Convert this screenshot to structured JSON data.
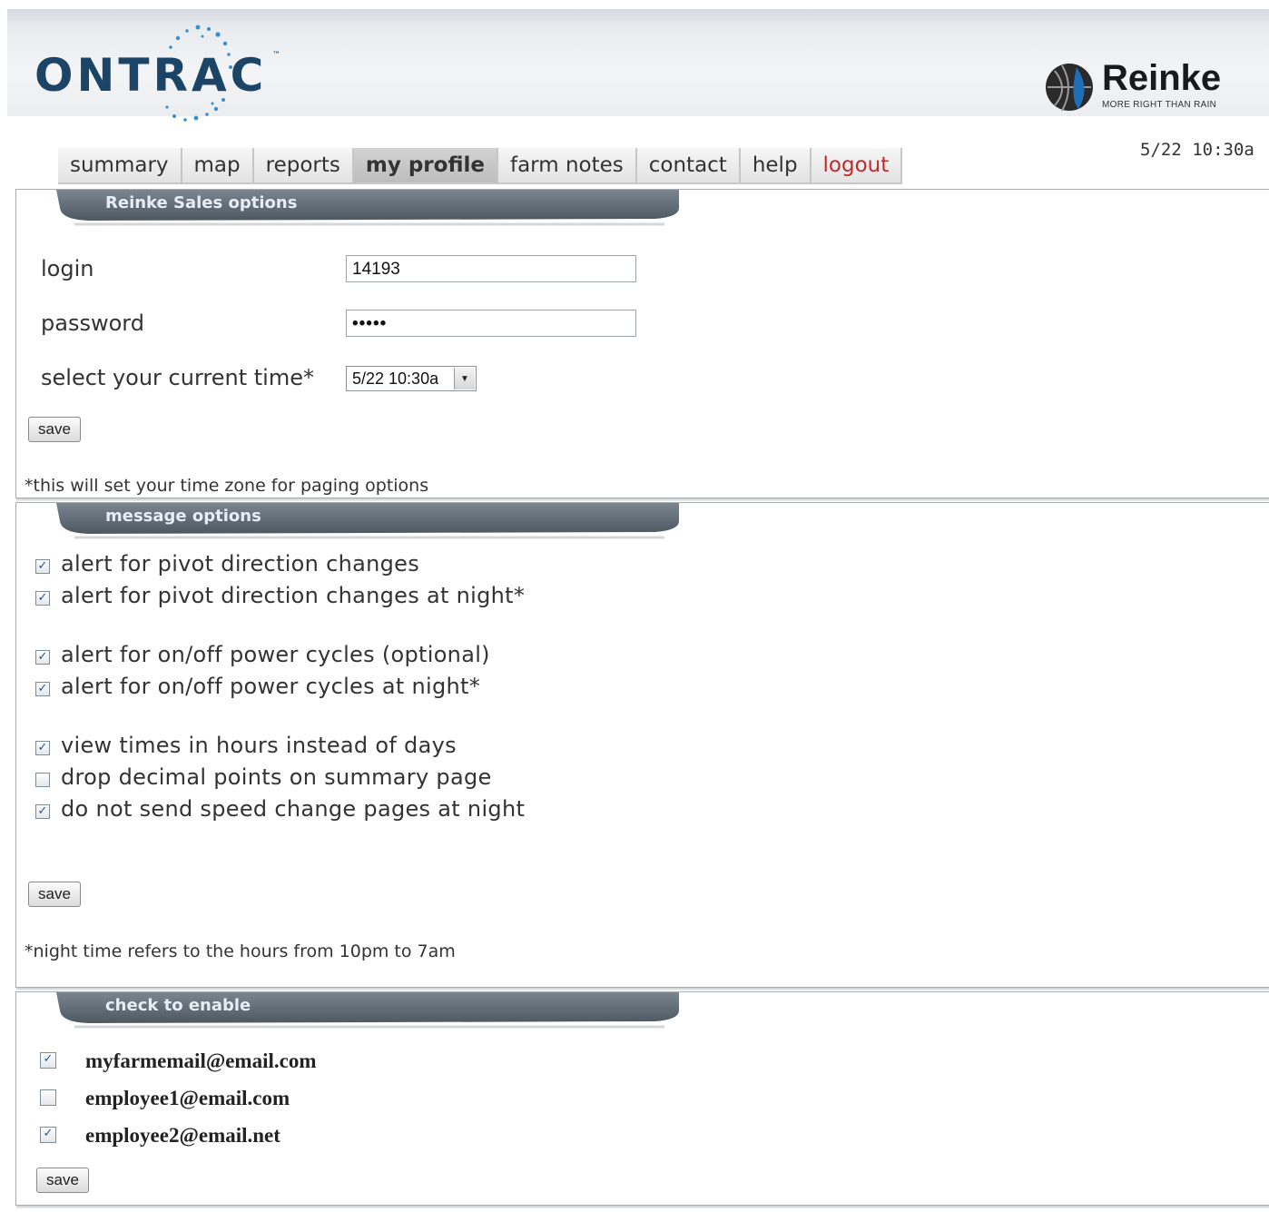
{
  "header": {
    "logo_left": "ONTRAC",
    "logo_right": "Reinke",
    "logo_right_tagline": "MORE RIGHT THAN RAIN"
  },
  "nav": {
    "tabs": [
      {
        "label": "summary"
      },
      {
        "label": "map"
      },
      {
        "label": "reports"
      },
      {
        "label": "my profile",
        "active": true
      },
      {
        "label": "farm notes"
      },
      {
        "label": "contact"
      },
      {
        "label": "help"
      },
      {
        "label": "logout",
        "color": "#c22a2a"
      }
    ],
    "clock": "5/22 10:30a"
  },
  "sales_panel": {
    "title": "Reinke Sales options",
    "login_label": "login",
    "login_value": "14193",
    "password_label": "password",
    "password_value": "•••••",
    "time_label": "select your current time*",
    "time_value": "5/22 10:30a",
    "save_label": "save",
    "note": "*this will set your time zone for paging options"
  },
  "message_panel": {
    "title": "message options",
    "options": [
      {
        "label": "alert for pivot direction changes",
        "checked": true
      },
      {
        "label": "alert for pivot direction changes at night*",
        "checked": true
      },
      {
        "label": "alert for on/off power cycles (optional)",
        "checked": true
      },
      {
        "label": "alert for on/off power cycles at night*",
        "checked": true
      },
      {
        "label": "view times in hours instead of days",
        "checked": true
      },
      {
        "label": "drop decimal points on summary page",
        "checked": false
      },
      {
        "label": "do not send speed change pages at night",
        "checked": true
      }
    ],
    "save_label": "save",
    "note": "*night time refers to the hours from 10pm to 7am"
  },
  "enable_panel": {
    "title": "check to enable",
    "emails": [
      {
        "address": "myfarmemail@email.com",
        "checked": true
      },
      {
        "address": "employee1@email.com",
        "checked": false
      },
      {
        "address": "employee2@email.net",
        "checked": true
      }
    ],
    "save_label": "save"
  },
  "colors": {
    "brand_blue": "#1c4466",
    "ribbon": "#5b6670",
    "logout_red": "#c22a2a"
  }
}
